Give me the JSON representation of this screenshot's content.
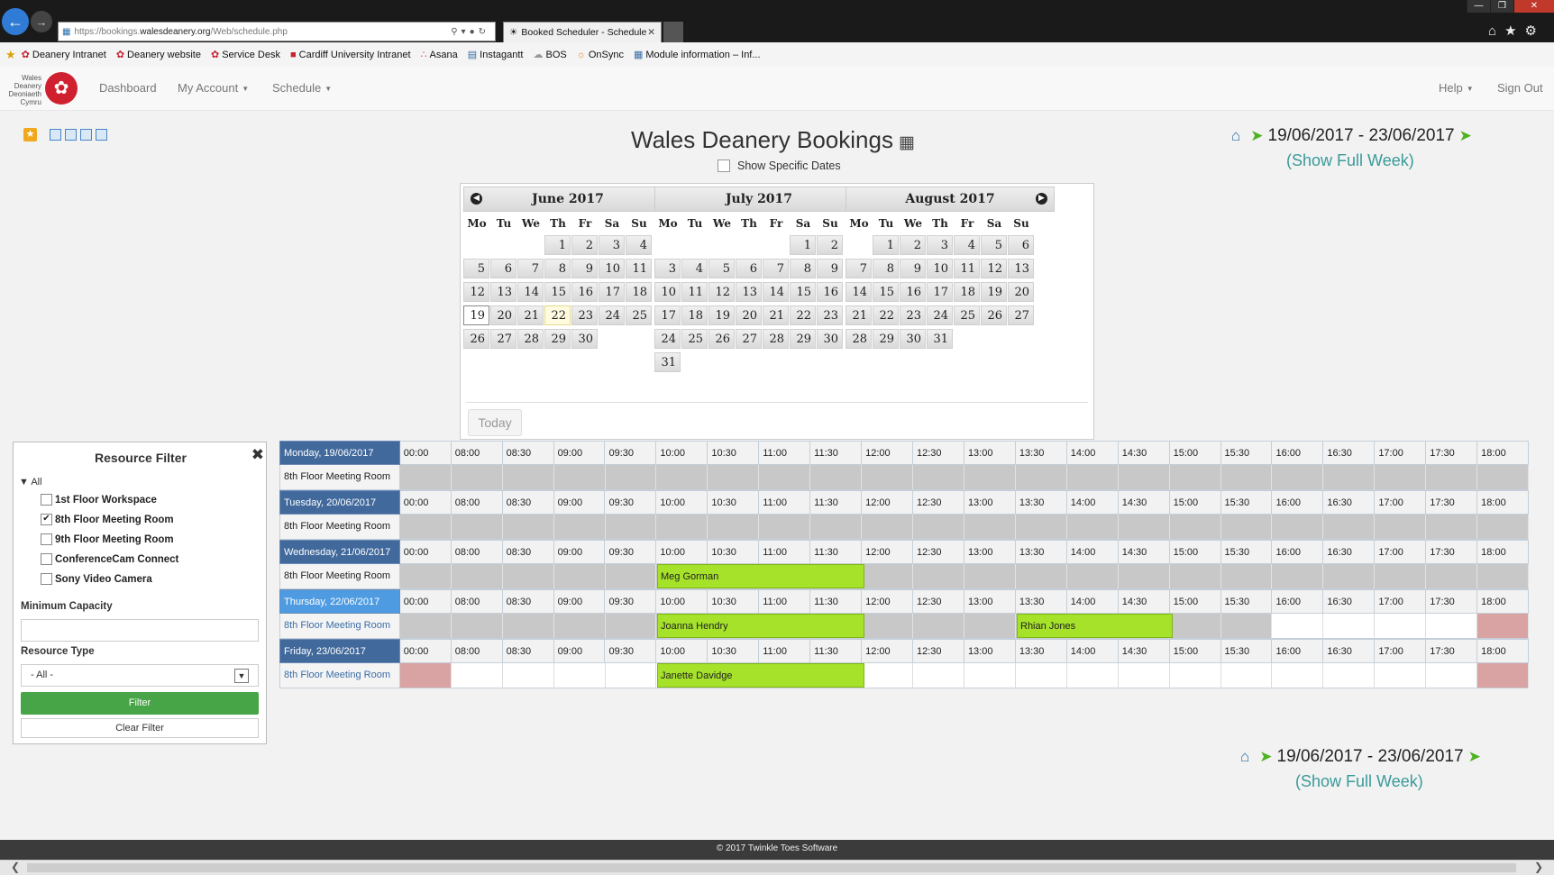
{
  "browser": {
    "url_prefix": "https://bookings.",
    "url_domain": "walesdeanery.org",
    "url_path": "/Web/schedule.php",
    "tab_title": "Booked Scheduler - Schedule",
    "favorites": [
      {
        "label": "Deanery Intranet",
        "icon": "dragon-icon"
      },
      {
        "label": "Deanery website",
        "icon": "dragon-icon"
      },
      {
        "label": "Service Desk",
        "icon": "dragon-icon"
      },
      {
        "label": "Cardiff University Intranet",
        "icon": "cardiff-icon"
      },
      {
        "label": "Asana",
        "icon": "asana-icon"
      },
      {
        "label": "Instagantt",
        "icon": "instagantt-icon"
      },
      {
        "label": "BOS",
        "icon": "cloud-icon"
      },
      {
        "label": "OnSync",
        "icon": "onsync-icon"
      },
      {
        "label": "Module information – Inf...",
        "icon": "page-icon"
      }
    ]
  },
  "app": {
    "logo_text": "Wales Deanery Deoniaeth Cymru",
    "nav": {
      "dashboard": "Dashboard",
      "my_account": "My Account",
      "schedule": "Schedule",
      "help": "Help",
      "sign_out": "Sign Out"
    },
    "title": "Wales Deanery Bookings",
    "show_specific_dates": "Show Specific Dates",
    "date_range": "19/06/2017 - 23/06/2017",
    "show_full_week": "(Show Full Week)",
    "today_button": "Today",
    "footer": "© 2017 Twinkle Toes Software",
    "colors": {
      "booking": "#a6e22a",
      "blocked": "#d9a3a3",
      "day_header": "#41699c",
      "current_day_header": "#4e9be1",
      "filter_button": "#47a447"
    }
  },
  "calendar": {
    "day_names": [
      "Mo",
      "Tu",
      "We",
      "Th",
      "Fr",
      "Sa",
      "Su"
    ],
    "months": [
      {
        "name": "June 2017",
        "weeks": [
          [
            "",
            "",
            "",
            "1",
            "2",
            "3",
            "4"
          ],
          [
            "5",
            "6",
            "7",
            "8",
            "9",
            "10",
            "11"
          ],
          [
            "12",
            "13",
            "14",
            "15",
            "16",
            "17",
            "18"
          ],
          [
            "19",
            "20",
            "21",
            "22",
            "23",
            "24",
            "25"
          ],
          [
            "26",
            "27",
            "28",
            "29",
            "30",
            "",
            ""
          ]
        ],
        "selected": "19",
        "today": "22"
      },
      {
        "name": "July 2017",
        "weeks": [
          [
            "",
            "",
            "",
            "",
            "",
            "1",
            "2"
          ],
          [
            "3",
            "4",
            "5",
            "6",
            "7",
            "8",
            "9"
          ],
          [
            "10",
            "11",
            "12",
            "13",
            "14",
            "15",
            "16"
          ],
          [
            "17",
            "18",
            "19",
            "20",
            "21",
            "22",
            "23"
          ],
          [
            "24",
            "25",
            "26",
            "27",
            "28",
            "29",
            "30"
          ],
          [
            "31",
            "",
            "",
            "",
            "",
            "",
            ""
          ]
        ]
      },
      {
        "name": "August 2017",
        "weeks": [
          [
            "",
            "1",
            "2",
            "3",
            "4",
            "5",
            "6"
          ],
          [
            "7",
            "8",
            "9",
            "10",
            "11",
            "12",
            "13"
          ],
          [
            "14",
            "15",
            "16",
            "17",
            "18",
            "19",
            "20"
          ],
          [
            "21",
            "22",
            "23",
            "24",
            "25",
            "26",
            "27"
          ],
          [
            "28",
            "29",
            "30",
            "31",
            "",
            "",
            ""
          ]
        ]
      }
    ]
  },
  "filter": {
    "title": "Resource Filter",
    "all_label": "All",
    "resources": [
      {
        "label": "1st Floor Workspace",
        "checked": false
      },
      {
        "label": "8th Floor Meeting Room",
        "checked": true
      },
      {
        "label": "9th Floor Meeting Room",
        "checked": false
      },
      {
        "label": "ConferenceCam Connect",
        "checked": false
      },
      {
        "label": "Sony Video Camera",
        "checked": false
      }
    ],
    "min_capacity_label": "Minimum Capacity",
    "resource_type_label": "Resource Type",
    "resource_type_value": "- All -",
    "filter_button": "Filter",
    "clear_button": "Clear Filter"
  },
  "schedule": {
    "times": [
      "00:00",
      "08:00",
      "08:30",
      "09:00",
      "09:30",
      "10:00",
      "10:30",
      "11:00",
      "11:30",
      "12:00",
      "12:30",
      "13:00",
      "13:30",
      "14:00",
      "14:30",
      "15:00",
      "15:30",
      "16:00",
      "16:30",
      "17:00",
      "17:30",
      "18:00"
    ],
    "days": [
      {
        "label": "Monday, 19/06/2017",
        "resource": "8th Floor Meeting Room",
        "slots": "PPPPPPPPPPPPPPPPPPPPPP",
        "bookings": [],
        "current": false,
        "link": false
      },
      {
        "label": "Tuesday, 20/06/2017",
        "resource": "8th Floor Meeting Room",
        "slots": "PPPPPPPPPPPPPPPPPPPPPP",
        "bookings": [],
        "current": false,
        "link": false
      },
      {
        "label": "Wednesday, 21/06/2017",
        "resource": "8th Floor Meeting Room",
        "slots": "PPPPPPPPPPPPPPPPPPPPPP",
        "bookings": [
          {
            "name": "Meg Gorman",
            "start": 5,
            "span": 4
          }
        ],
        "current": false,
        "link": false
      },
      {
        "label": "Thursday, 22/06/2017",
        "resource": "8th Floor Meeting Room",
        "slots": "PPPPPPPPPPPPPPPPPOOOOB",
        "bookings": [
          {
            "name": "Joanna Hendry",
            "start": 5,
            "span": 4
          },
          {
            "name": "Rhian Jones",
            "start": 12,
            "span": 3
          }
        ],
        "current": true,
        "link": true
      },
      {
        "label": "Friday, 23/06/2017",
        "resource": "8th Floor Meeting Room",
        "slots": "BOOOOOOOOOOOOOOOOOOOOB",
        "bookings": [
          {
            "name": "Janette Davidge",
            "start": 5,
            "span": 4
          }
        ],
        "current": false,
        "link": true
      }
    ]
  }
}
